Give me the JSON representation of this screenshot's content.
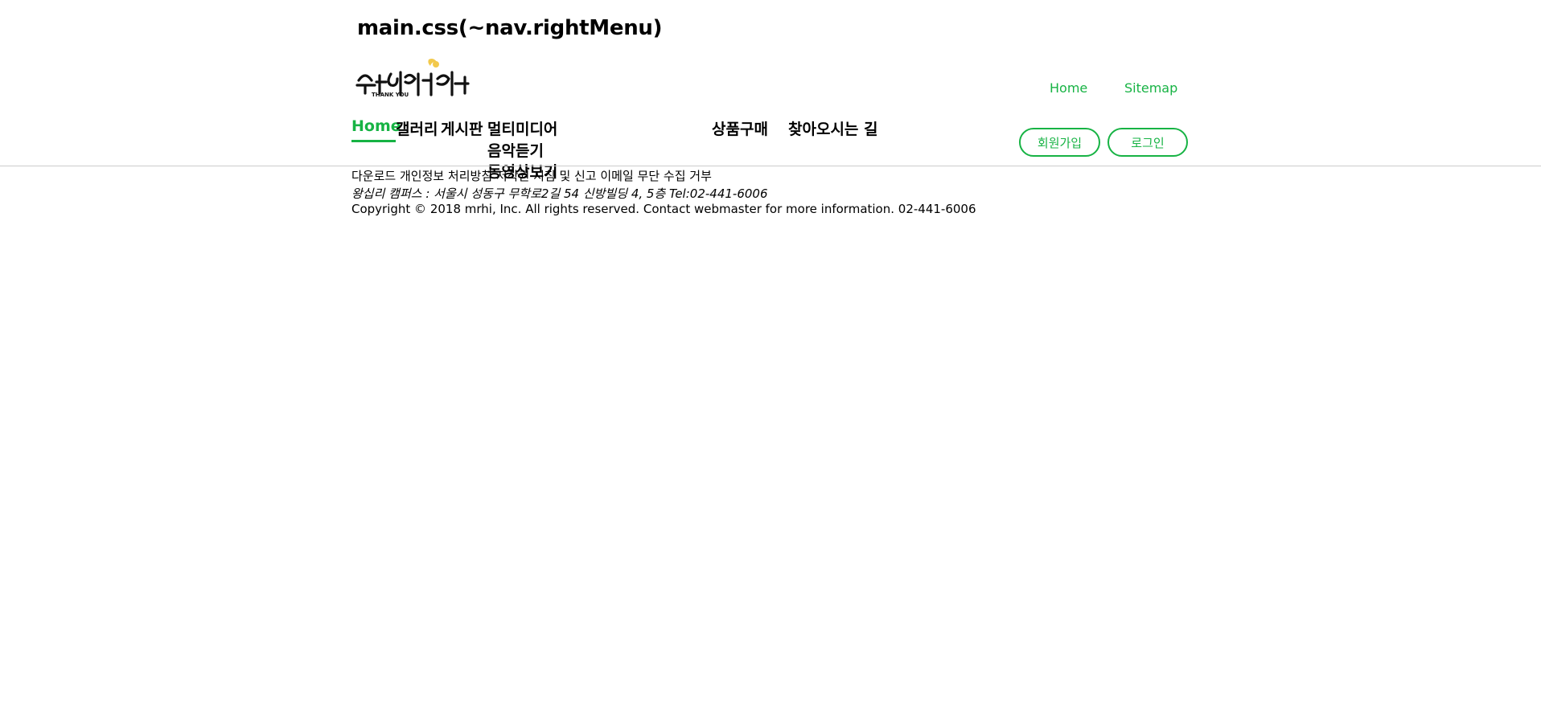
{
  "page_title": "main.css(~nav.rightMenu)",
  "logo": {
    "icon": "thank-you-calligraphy-logo",
    "text": "수고하셨습니다",
    "subtext": "THANK YOU"
  },
  "top_links": [
    "Home",
    "Sitemap"
  ],
  "gnb": {
    "home": "Home",
    "gallery": "갤러리",
    "board": "게시판",
    "multimedia": "멀티미디어",
    "multimedia_sub": [
      "음악듣기",
      "동영상보기"
    ],
    "shop": "상품구매",
    "directions": "찾아오시는 길"
  },
  "buttons": {
    "join": "회원가입",
    "login": "로그인"
  },
  "footer": {
    "links": "다운로드 개인정보 처리방침 저작권 지침 및 신고 이메일 무단 수집 거부",
    "address": "왕십리 캠퍼스 : 서울시 성동구 무학로2길 54 신방빌딩 4, 5층 Tel:02-441-6006",
    "copyright": "Copyright © 2018 mrhi, Inc. All rights reserved. Contact webmaster for more information. 02-441-6006"
  },
  "colors": {
    "accent": "#17b344",
    "text": "#000000",
    "divider": "#cccccc"
  }
}
